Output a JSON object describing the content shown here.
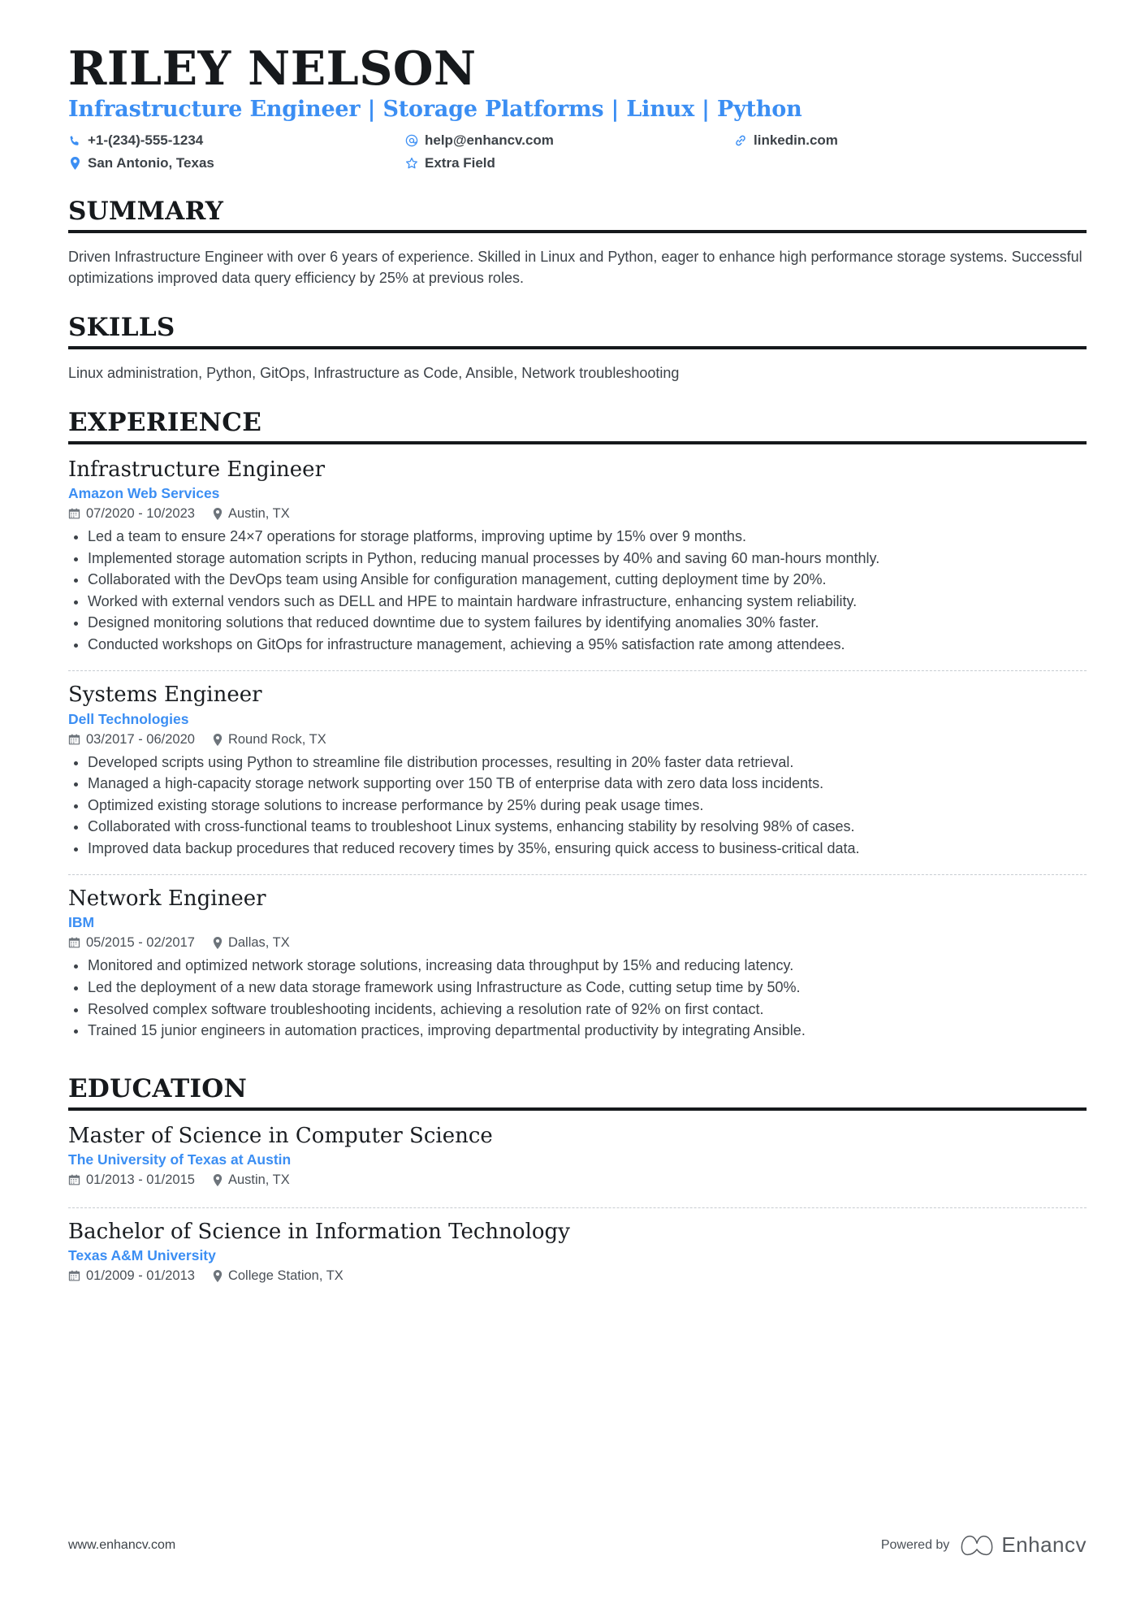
{
  "accent_color": "#3b8ef3",
  "text_color": "#3c4248",
  "heading_color": "#16191c",
  "header": {
    "name": "RILEY NELSON",
    "headline": "Infrastructure Engineer | Storage Platforms | Linux | Python",
    "contacts": [
      {
        "icon": "phone-icon",
        "label": "+1-(234)-555-1234"
      },
      {
        "icon": "email-icon",
        "label": "help@enhancv.com"
      },
      {
        "icon": "link-icon",
        "label": "linkedin.com"
      },
      {
        "icon": "location-pin-icon",
        "label": "San Antonio, Texas"
      },
      {
        "icon": "star-icon",
        "label": "Extra Field"
      }
    ]
  },
  "sections": {
    "summary": {
      "title": "SUMMARY",
      "text": "Driven Infrastructure Engineer with over 6 years of experience. Skilled in Linux and Python, eager to enhance high performance storage systems. Successful optimizations improved data query efficiency by 25% at previous roles."
    },
    "skills": {
      "title": "SKILLS",
      "text": "Linux administration, Python, GitOps, Infrastructure as Code, Ansible, Network troubleshooting"
    },
    "experience": {
      "title": "EXPERIENCE",
      "entries": [
        {
          "title": "Infrastructure Engineer",
          "org": "Amazon Web Services",
          "dates": "07/2020 - 10/2023",
          "location": "Austin, TX",
          "bullets": [
            "Led a team to ensure 24×7 operations for storage platforms, improving uptime by 15% over 9 months.",
            "Implemented storage automation scripts in Python, reducing manual processes by 40% and saving 60 man-hours monthly.",
            "Collaborated with the DevOps team using Ansible for configuration management, cutting deployment time by 20%.",
            "Worked with external vendors such as DELL and HPE to maintain hardware infrastructure, enhancing system reliability.",
            "Designed monitoring solutions that reduced downtime due to system failures by identifying anomalies 30% faster.",
            "Conducted workshops on GitOps for infrastructure management, achieving a 95% satisfaction rate among attendees."
          ]
        },
        {
          "title": "Systems Engineer",
          "org": "Dell Technologies",
          "dates": "03/2017 - 06/2020",
          "location": "Round Rock, TX",
          "bullets": [
            "Developed scripts using Python to streamline file distribution processes, resulting in 20% faster data retrieval.",
            "Managed a high-capacity storage network supporting over 150 TB of enterprise data with zero data loss incidents.",
            "Optimized existing storage solutions to increase performance by 25% during peak usage times.",
            "Collaborated with cross-functional teams to troubleshoot Linux systems, enhancing stability by resolving 98% of cases.",
            "Improved data backup procedures that reduced recovery times by 35%, ensuring quick access to business-critical data."
          ]
        },
        {
          "title": "Network Engineer",
          "org": "IBM",
          "dates": "05/2015 - 02/2017",
          "location": "Dallas, TX",
          "bullets": [
            "Monitored and optimized network storage solutions, increasing data throughput by 15% and reducing latency.",
            "Led the deployment of a new data storage framework using Infrastructure as Code, cutting setup time by 50%.",
            "Resolved complex software troubleshooting incidents, achieving a resolution rate of 92% on first contact.",
            "Trained 15 junior engineers in automation practices, improving departmental productivity by integrating Ansible."
          ]
        }
      ]
    },
    "education": {
      "title": "EDUCATION",
      "entries": [
        {
          "title": "Master of Science in Computer Science",
          "org": "The University of Texas at Austin",
          "dates": "01/2013 - 01/2015",
          "location": "Austin, TX"
        },
        {
          "title": "Bachelor of Science in Information Technology",
          "org": "Texas A&M University",
          "dates": "01/2009 - 01/2013",
          "location": "College Station, TX"
        }
      ]
    }
  },
  "footer": {
    "url": "www.enhancv.com",
    "powered_by": "Powered by",
    "brand": "Enhancv"
  }
}
